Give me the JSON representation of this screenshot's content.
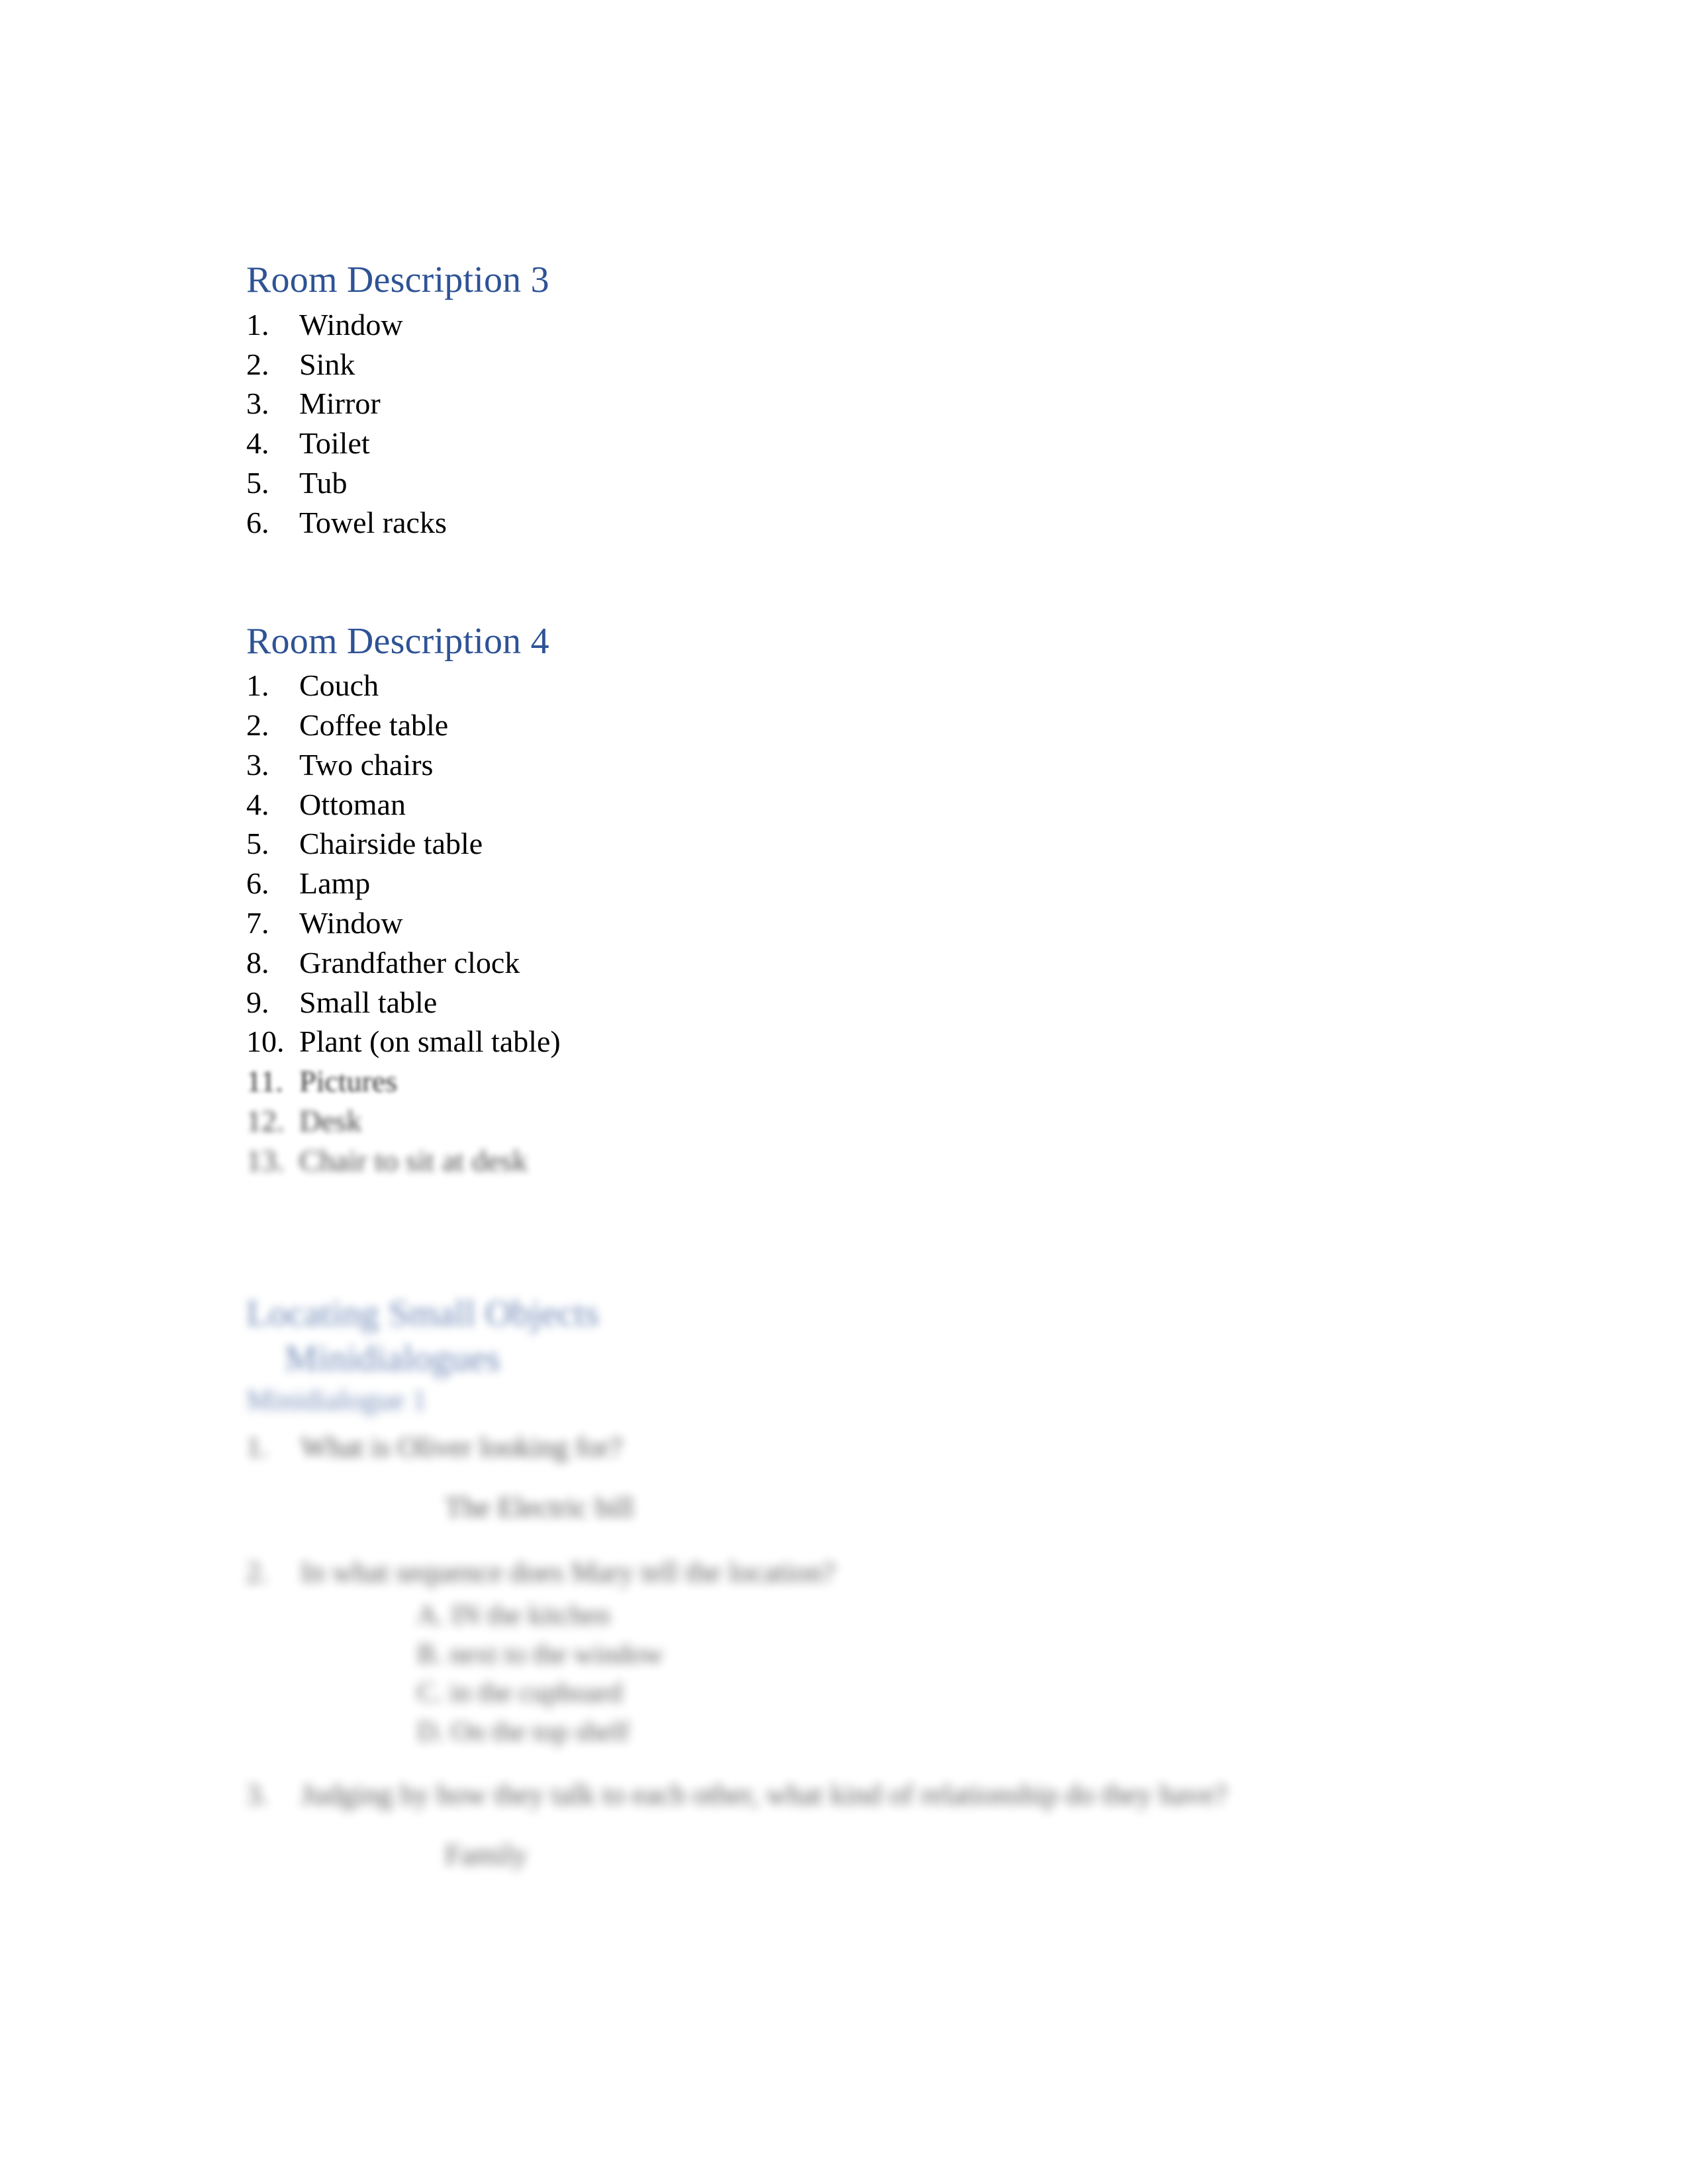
{
  "document": {
    "heading_color": "#2E5395",
    "body_color": "#000000",
    "page_background": "#FFFFFF"
  },
  "sections": {
    "room3": {
      "heading": "Room Description 3",
      "items": [
        {
          "num": "1.",
          "label": "Window"
        },
        {
          "num": "2.",
          "label": "Sink"
        },
        {
          "num": "3.",
          "label": "Mirror"
        },
        {
          "num": "4.",
          "label": "Toilet"
        },
        {
          "num": "5.",
          "label": "Tub"
        },
        {
          "num": "6.",
          "label": "Towel racks"
        }
      ]
    },
    "room4": {
      "heading": "Room Description 4",
      "items": [
        {
          "num": "1.",
          "label": "Couch"
        },
        {
          "num": "2.",
          "label": "Coffee table"
        },
        {
          "num": "3.",
          "label": "Two chairs"
        },
        {
          "num": "4.",
          "label": "Ottoman"
        },
        {
          "num": "5.",
          "label": "Chairside table"
        },
        {
          "num": "6.",
          "label": "Lamp"
        },
        {
          "num": "7.",
          "label": "Window"
        },
        {
          "num": "8.",
          "label": "Grandfather clock"
        },
        {
          "num": "9.",
          "label": "Small table"
        },
        {
          "num": "10.",
          "label": "Plant (on small table)"
        },
        {
          "num": "11.",
          "label": "Pictures"
        },
        {
          "num": "12.",
          "label": "Desk"
        },
        {
          "num": "13.",
          "label": "Chair to sit at desk"
        }
      ]
    },
    "locating": {
      "heading": "Locating Small Objects",
      "subheading": "Minidialogues",
      "group_label": "Minidialogue 1",
      "questions": [
        {
          "num": "1.",
          "text": "What is Oliver looking for?",
          "answer": "The Electric bill"
        },
        {
          "num": "2.",
          "text": "In what sequence does Mary tell the location?",
          "answer": "",
          "choices": [
            "A. IN the kitchen",
            "B. next to the window",
            "C. in the cupboard",
            "D. On the top shelf"
          ]
        },
        {
          "num": "3.",
          "text": "Judging by how they talk to each other, what kind of relationship do they have?",
          "answer": "Family"
        }
      ]
    }
  }
}
